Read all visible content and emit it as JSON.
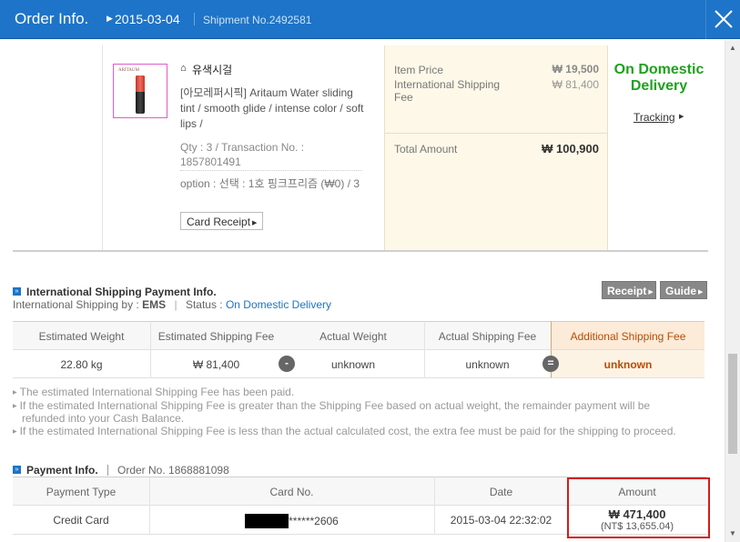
{
  "header": {
    "title": "Order Info.",
    "date": "2015-03-04",
    "shipment": "Shipment No.2492581"
  },
  "product": {
    "image_brand": "ARITAUM",
    "shop_name": "유색시걸",
    "name": "[아모레퍼시픽] Aritaum Water sliding tint / smooth glide / intense color / soft lips /",
    "qty_line": "Qty : 3 / Transaction No. : 1857801491",
    "option": "option : 선택 : 1호 핑크프리즘 (₩0) / 3",
    "card_receipt": "Card Receipt"
  },
  "price": {
    "item_price_label": "Item Price",
    "item_price": "₩ 19,500",
    "intl_fee_label": "International Shipping Fee",
    "intl_fee": "₩ 81,400",
    "total_label": "Total Amount",
    "total": "₩ 100,900"
  },
  "status": {
    "label": "On Domestic Delivery",
    "tracking": "Tracking"
  },
  "intl": {
    "title": "International Shipping Payment Info.",
    "ship_by_label": "International Shipping by :",
    "ship_by": "EMS",
    "status_label": "Status :",
    "status": "On Domestic Delivery",
    "receipt_btn": "Receipt",
    "guide_btn": "Guide",
    "headers": [
      "Estimated Weight",
      "Estimated Shipping Fee",
      "Actual Weight",
      "Actual Shipping Fee",
      "Additional Shipping Fee"
    ],
    "values": [
      "22.80 kg",
      "₩ 81,400",
      "unknown",
      "unknown",
      "unknown"
    ],
    "minus_op": "-",
    "equals_op": "=",
    "notes": [
      "The estimated International Shipping Fee has been paid.",
      "If the estimated International Shipping Fee is greater than the Shipping Fee based on actual weight, the remainder payment will be",
      "refunded into your Cash Balance.",
      "If the estimated International Shipping Fee is less than the actual calculated cost, the extra fee must be paid for the shipping to proceed."
    ]
  },
  "payment": {
    "title": "Payment Info.",
    "order_no": "Order No. 1868881098",
    "headers": [
      "Payment Type",
      "Card No.",
      "Date",
      "Amount"
    ],
    "type": "Credit Card",
    "card_no": "******2606",
    "date": "2015-03-04 22:32:02",
    "amount": "₩ 471,400",
    "amount_ntd": "(NT$ 13,655.04)"
  },
  "colors": {
    "header_blue": "#1d74c8",
    "status_green": "#1ea21e",
    "additional_orange": "#c04a00",
    "highlight_red": "#d21c1c"
  }
}
